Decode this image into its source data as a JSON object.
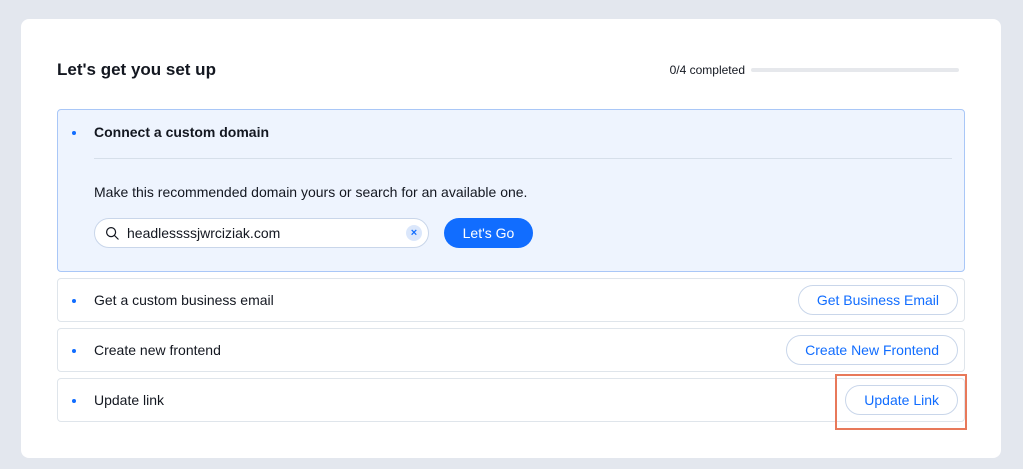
{
  "header": {
    "title": "Let's get you set up",
    "progress_text": "0/4 completed",
    "progress_fraction": 0
  },
  "domain_step": {
    "title": "Connect a custom domain",
    "description": "Make this recommended domain yours or search for an available one.",
    "search_value": "headlessssjwrciziak.com",
    "clear_icon": "×",
    "button_label": "Let's Go"
  },
  "steps": [
    {
      "label": "Get a custom business email",
      "button": "Get Business Email"
    },
    {
      "label": "Create new frontend",
      "button": "Create New Frontend"
    },
    {
      "label": "Update link",
      "button": "Update Link"
    }
  ],
  "colors": {
    "accent": "#116dff",
    "highlight": "#e8795a"
  }
}
